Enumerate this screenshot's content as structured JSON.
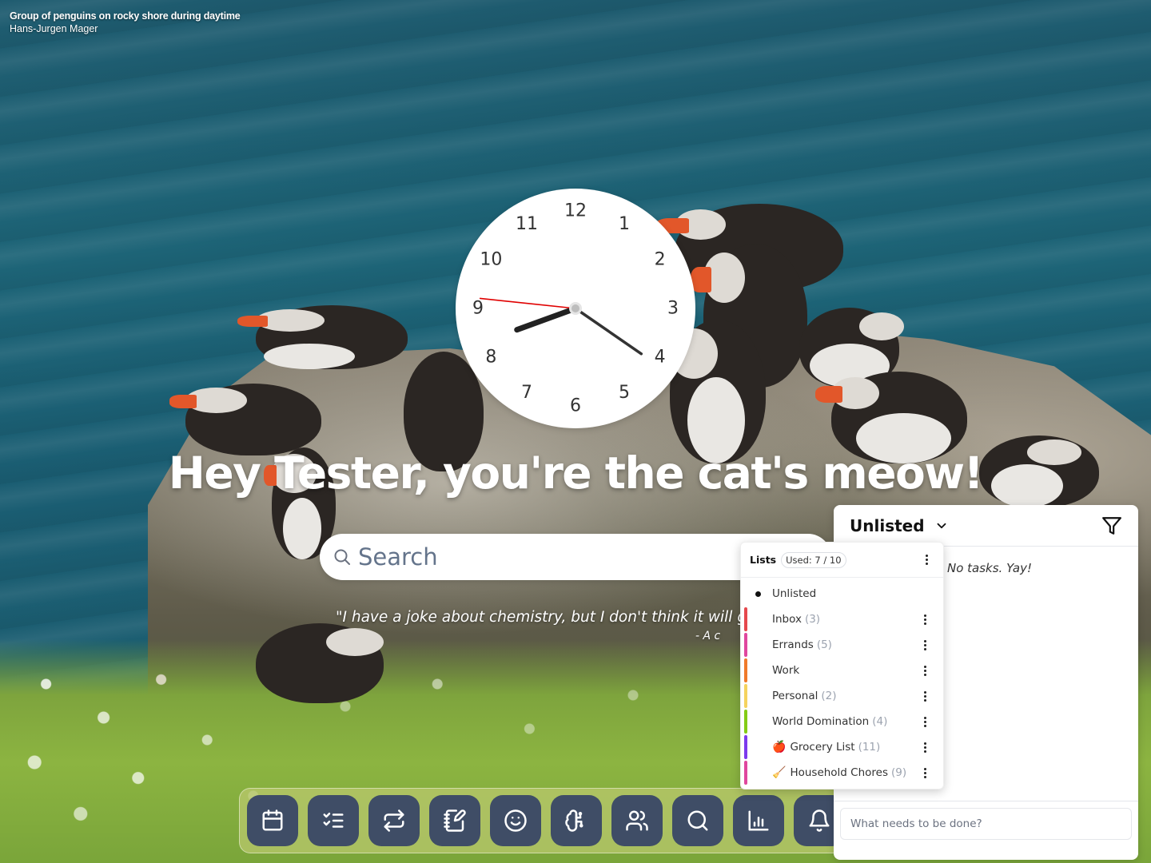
{
  "photo_credit": {
    "title": "Group of penguins on rocky shore during daytime",
    "author": "Hans-Jurgen Mager"
  },
  "clock": {
    "numerals": [
      "12",
      "1",
      "2",
      "3",
      "4",
      "5",
      "6",
      "7",
      "8",
      "9",
      "10",
      "11"
    ],
    "time": {
      "hours": 8,
      "minutes": 20,
      "seconds": 46
    },
    "colors": {
      "hour_hand": "#222222",
      "minute_hand": "#333333",
      "second_hand": "#e00000"
    }
  },
  "greeting": "Hey Tester, you're the cat's meow!",
  "search": {
    "placeholder": "Search",
    "value": ""
  },
  "quote": {
    "text": "\"I have a joke about chemistry, but I don't think it will get a reaction.\"",
    "author": "- A c"
  },
  "dock": {
    "items": [
      {
        "name": "calendar",
        "icon": "calendar-icon"
      },
      {
        "name": "tasks",
        "icon": "list-checks-icon"
      },
      {
        "name": "habits",
        "icon": "repeat-icon"
      },
      {
        "name": "notes",
        "icon": "notebook-pen-icon"
      },
      {
        "name": "mood",
        "icon": "smile-icon"
      },
      {
        "name": "ai",
        "icon": "brain-circuit-icon"
      },
      {
        "name": "contacts",
        "icon": "users-icon"
      },
      {
        "name": "search",
        "icon": "search-icon"
      },
      {
        "name": "stats",
        "icon": "bar-chart-icon"
      },
      {
        "name": "notifications",
        "icon": "bell-icon"
      }
    ],
    "colors": {
      "button_bg": "#3f4d66"
    }
  },
  "tasks_panel": {
    "title": "Unlisted",
    "empty_message": "No tasks. Yay!",
    "new_task_placeholder": "What needs to be done?",
    "new_task_value": ""
  },
  "lists_menu": {
    "title": "Lists",
    "usage": "Used: 7 / 10",
    "selected": "Unlisted",
    "items": [
      {
        "label": "Unlisted",
        "count": "",
        "emoji": "",
        "color": ""
      },
      {
        "label": "Inbox",
        "count": "(3)",
        "emoji": "",
        "color": "#e5484d"
      },
      {
        "label": "Errands",
        "count": "(5)",
        "emoji": "",
        "color": "#e0479e"
      },
      {
        "label": "Work",
        "count": "",
        "emoji": "",
        "color": "#f07a2a"
      },
      {
        "label": "Personal",
        "count": "(2)",
        "emoji": "",
        "color": "#f5d35e"
      },
      {
        "label": "World Domination",
        "count": "(4)",
        "emoji": "",
        "color": "#84cc16"
      },
      {
        "label": "Grocery List",
        "count": "(11)",
        "emoji": "🍎",
        "color": "#7c3aed"
      },
      {
        "label": "Household Chores",
        "count": "(9)",
        "emoji": "🧹",
        "color": "#e0479e"
      }
    ]
  }
}
